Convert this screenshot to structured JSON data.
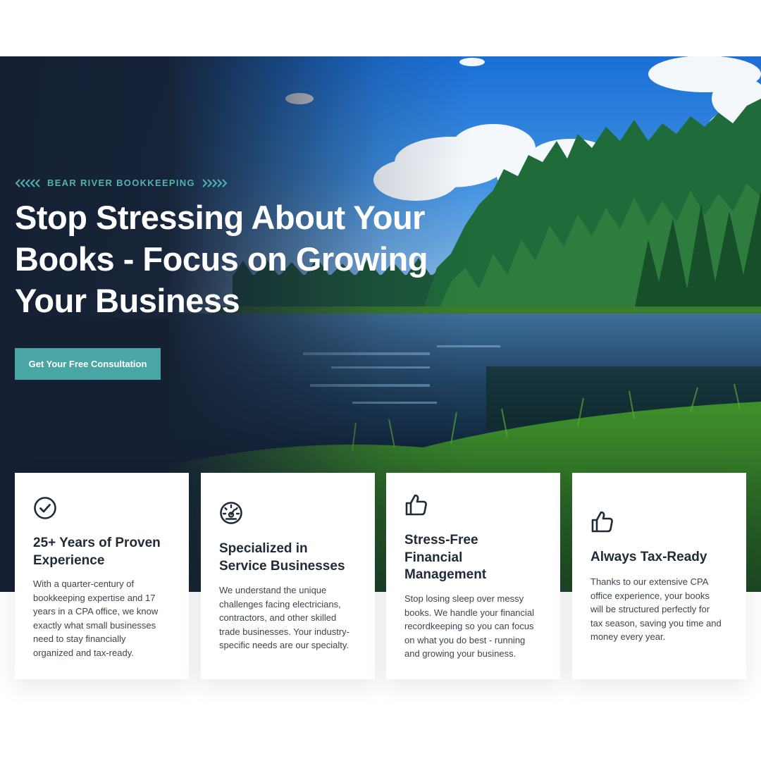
{
  "hero": {
    "eyebrow": "BEAR RIVER BOOKKEEPING",
    "headline_lines": [
      "Stop Stressing About Your",
      "Books - Focus on Growing",
      "Your Business"
    ],
    "cta_label": "Get Your Free Consultation"
  },
  "colors": {
    "accent": "#4fb3ae",
    "button": "#4aa6a5",
    "hero_dark": "#152033",
    "heading_text": "#1f2b36",
    "body_text": "#3a4550"
  },
  "features": [
    {
      "icon": "check-circle-icon",
      "title_lines": [
        "25+ Years of Proven",
        "Experience"
      ],
      "text_lines": [
        "With a quarter-century of",
        "bookkeeping expertise and 17",
        "years in a CPA office, we know",
        "exactly what small businesses",
        "need to stay financially",
        "organized and tax-ready."
      ]
    },
    {
      "icon": "gauge-icon",
      "title_lines": [
        "Specialized in",
        "Service Businesses"
      ],
      "text_lines": [
        "We understand the unique",
        "challenges facing electricians,",
        "contractors, and other skilled",
        "trade businesses. Your industry-",
        "specific needs are our specialty."
      ]
    },
    {
      "icon": "thumbs-up-icon",
      "title_lines": [
        "Stress-Free",
        "Financial",
        "Management"
      ],
      "text_lines": [
        "Stop losing sleep over messy",
        "books. We handle your financial",
        "recordkeeping so you can focus",
        "on what you do best - running",
        "and growing your business."
      ]
    },
    {
      "icon": "thumbs-up-icon",
      "title_lines": [
        "Always Tax-Ready"
      ],
      "text_lines": [
        "Thanks to our extensive CPA",
        "office experience, your books",
        "will be structured perfectly for",
        "tax season, saving you time and",
        "money every year."
      ]
    }
  ]
}
